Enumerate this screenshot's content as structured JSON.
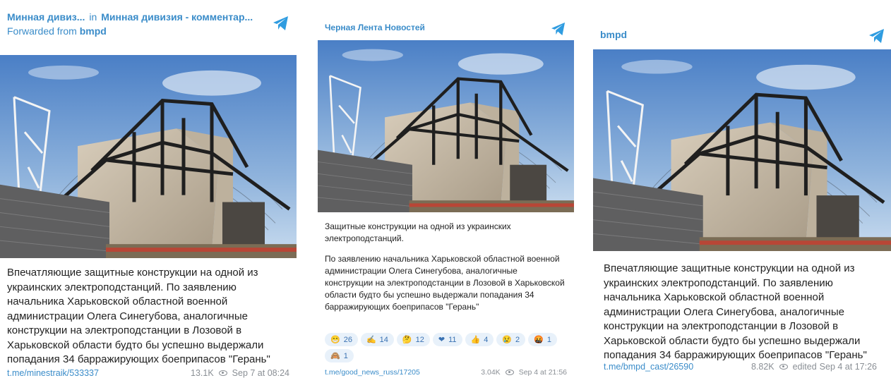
{
  "posts": [
    {
      "channel": "Минная дивиз...",
      "in_word": "in",
      "group": "Минная дивизия - комментар...",
      "forwarded_prefix": "Forwarded from",
      "forwarded_from": "bmpd",
      "caption": "Впечатляющие защитные конструкции на одной из украинских электроподстанций. По заявлению начальника Харьковской областной военной администрации Олега Синегубова, аналогичные конструкции на электроподстанции в Лозовой в Харьковской области будто бы успешно выдержали попадания 34 барражирующих боеприпасов \"Герань\"",
      "link": "t.me/minestraik/533337",
      "views": "13.1K",
      "date": "Sep 7 at 08:24"
    },
    {
      "channel": "Черная Лента Новостей",
      "caption_p1": "Защитные конструкции на одной из украинских электроподстанций.",
      "caption_p2": "По заявлению начальника Харьковской областной военной администрации Олега Синегубова, аналогичные конструкции на электроподстанции в Лозовой в Харьковской области будто бы успешно выдержали попадания 34 барражирующих боеприпасов \"Герань\"",
      "reactions": [
        {
          "emoji": "😁",
          "count": "26"
        },
        {
          "emoji": "✍",
          "count": "14"
        },
        {
          "emoji": "🤔",
          "count": "12"
        },
        {
          "emoji": "❤",
          "count": "11"
        },
        {
          "emoji": "👍",
          "count": "4"
        },
        {
          "emoji": "😢",
          "count": "2"
        },
        {
          "emoji": "🤬",
          "count": "1"
        },
        {
          "emoji": "🙈",
          "count": "1"
        }
      ],
      "link": "t.me/good_news_russ/17205",
      "views": "3.04K",
      "date": "Sep 4 at 21:56"
    },
    {
      "channel": "bmpd",
      "caption": "Впечатляющие защитные конструкции на одной из украинских электроподстанций. По заявлению начальника Харьковской областной военной администрации Олега Синегубова, аналогичные конструкции на электроподстанции в Лозовой в Харьковской области будто бы успешно выдержали попадания 34 барражирующих боеприпасов \"Герань\"",
      "link": "t.me/bmpd_cast/26590",
      "views": "8.82K",
      "edited": "edited",
      "date": "Sep 4 at 17:26"
    }
  ],
  "colors": {
    "accent": "#3a8cc9",
    "meta": "#8a8f95",
    "reaction_bg": "#e8f1fa"
  },
  "icons": {
    "telegram": "telegram-logo-icon",
    "views": "eye-icon"
  }
}
